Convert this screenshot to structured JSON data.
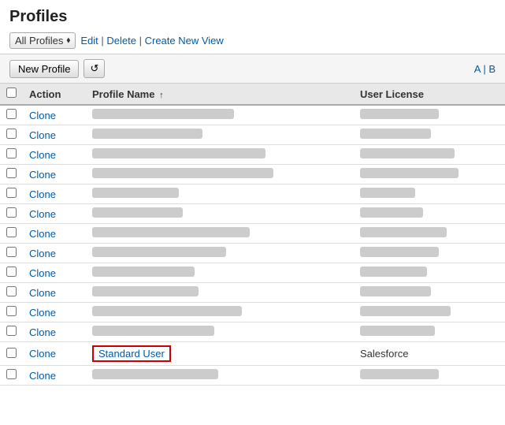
{
  "page": {
    "title": "Profiles"
  },
  "view_controls": {
    "select_label": "All Profiles",
    "edit_label": "Edit",
    "delete_label": "Delete",
    "create_label": "Create New View",
    "separator": "|"
  },
  "toolbar": {
    "new_profile_label": "New Profile",
    "refresh_icon": "↺",
    "pagination": {
      "a_label": "A",
      "b_label": "B",
      "separator": "|"
    }
  },
  "table": {
    "headers": {
      "action": "Action",
      "profile_name": "Profile Name",
      "sort_indicator": "↑",
      "user_license": "User License"
    },
    "rows": [
      {
        "id": 1,
        "action": "Clone",
        "profile_name_blurred": true,
        "profile_width": 180,
        "license_blurred": true,
        "license_width": 100,
        "highlighted": false
      },
      {
        "id": 2,
        "action": "Clone",
        "profile_name_blurred": true,
        "profile_width": 140,
        "license_blurred": true,
        "license_width": 90,
        "highlighted": false
      },
      {
        "id": 3,
        "action": "Clone",
        "profile_name_blurred": true,
        "profile_width": 220,
        "license_blurred": true,
        "license_width": 120,
        "highlighted": false
      },
      {
        "id": 4,
        "action": "Clone",
        "profile_name_blurred": true,
        "profile_width": 230,
        "license_blurred": true,
        "license_width": 125,
        "highlighted": false
      },
      {
        "id": 5,
        "action": "Clone",
        "profile_name_blurred": true,
        "profile_width": 110,
        "license_blurred": true,
        "license_width": 70,
        "highlighted": false
      },
      {
        "id": 6,
        "action": "Clone",
        "profile_name_blurred": true,
        "profile_width": 115,
        "license_blurred": true,
        "license_width": 80,
        "highlighted": false
      },
      {
        "id": 7,
        "action": "Clone",
        "profile_name_blurred": true,
        "profile_width": 200,
        "license_blurred": true,
        "license_width": 110,
        "highlighted": false
      },
      {
        "id": 8,
        "action": "Clone",
        "profile_name_blurred": true,
        "profile_width": 170,
        "license_blurred": true,
        "license_width": 100,
        "highlighted": false
      },
      {
        "id": 9,
        "action": "Clone",
        "profile_name_blurred": true,
        "profile_width": 130,
        "license_blurred": true,
        "license_width": 85,
        "highlighted": false
      },
      {
        "id": 10,
        "action": "Clone",
        "profile_name_blurred": true,
        "profile_width": 135,
        "license_blurred": true,
        "license_width": 90,
        "highlighted": false
      },
      {
        "id": 11,
        "action": "Clone",
        "profile_name_blurred": true,
        "profile_width": 190,
        "license_blurred": true,
        "license_width": 115,
        "highlighted": false
      },
      {
        "id": 12,
        "action": "Clone",
        "profile_name_blurred": true,
        "profile_width": 155,
        "license_blurred": true,
        "license_width": 95,
        "highlighted": false
      },
      {
        "id": 13,
        "action": "Clone",
        "profile_name": "Standard User",
        "profile_name_blurred": false,
        "license": "Salesforce",
        "license_blurred": false,
        "highlighted": true
      },
      {
        "id": 14,
        "action": "Clone",
        "profile_name_blurred": true,
        "profile_width": 160,
        "license_blurred": true,
        "license_width": 100,
        "highlighted": false
      }
    ]
  },
  "colors": {
    "link": "#015ba7",
    "highlight_border": "#cc0000",
    "blurred": "#c8c8c8"
  }
}
